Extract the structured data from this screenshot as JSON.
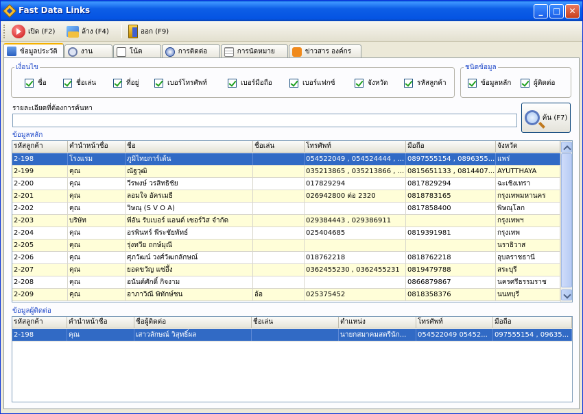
{
  "window": {
    "title": "Fast Data Links"
  },
  "toolbar": {
    "open": "เปิด (F2)",
    "clear": "ล้าง (F4)",
    "exit": "ออก (F9)"
  },
  "tabs": [
    "ข้อมูลประวัติ",
    "งาน",
    "โน้ต",
    "การติดต่อ",
    "การนัดหมาย",
    "ข่าวสาร องค์กร"
  ],
  "conditions": {
    "legend": "เงื่อนไข",
    "items": [
      "ชื่อ",
      "ชื่อเล่น",
      "ที่อยู่",
      "เบอร์โทรศัพท์",
      "เบอร์มือถือ",
      "เบอร์แฟกซ์",
      "จังหวัด",
      "รหัสลูกค้า"
    ]
  },
  "datatype": {
    "legend": "ชนิดข้อมูล",
    "items": [
      "ข้อมูลหลัก",
      "ผู้ติดต่อ"
    ]
  },
  "search": {
    "label": "รายละเอียดที่ต้องการค้นหา",
    "value": "",
    "button": "ค้น (F7)"
  },
  "main_grid": {
    "label": "ข้อมูลหลัก",
    "columns": [
      "รหัสลูกค้า",
      "คำนำหน้าชื่อ",
      "ชื่อ",
      "ชื่อเล่น",
      "โทรศัพท์",
      "มือถือ",
      "จังหวัด"
    ],
    "rows": [
      [
        "2-198",
        "โรงแรม",
        "ภูมิไทยการ์เด้น",
        "",
        "054522049 , 054524444 , ...",
        "0897555154 , 0896355...",
        "แพร่"
      ],
      [
        "2-199",
        "คุณ",
        "ณัฐวุฒิ",
        "",
        "035213865 , 035213866 , ...",
        "0815651133 , 0814407...",
        "AYUTTHAYA"
      ],
      [
        "2-200",
        "คุณ",
        "วีรพงษ์  วรสิทธิชัย",
        "",
        "017829294",
        "0817829294",
        "ฉะเชิงเทรา"
      ],
      [
        "2-201",
        "คุณ",
        "ลอมใจ  อัครเมธี",
        "",
        "026942800 ต่อ 2320",
        "0818783165",
        "กรุงเทพมหานคร"
      ],
      [
        "2-202",
        "คุณ",
        "วิษณุ (S V O A)",
        "",
        "",
        "0817858400",
        "พิษณุโลก"
      ],
      [
        "2-203",
        "บริษัท",
        "พีอัน รับเบอร์ แอนด์ เซอร์วิส จำกัด",
        "",
        "029384443 , 029386911",
        "",
        "กรุงเทพฯ"
      ],
      [
        "2-204",
        "คุณ",
        "อรพินทร์ พีระชัยพัทธ์",
        "",
        "025404685",
        "0819391981",
        "กรุงเทพ"
      ],
      [
        "2-205",
        "คุณ",
        "รุ่งทวีย  ถกษ์มุณี",
        "",
        "",
        "",
        "นราธิวาส"
      ],
      [
        "2-206",
        "คุณ",
        "ศุภวัฒน์  วงศ์วัฒกลักษณ์",
        "",
        "018762218",
        "0818762218",
        "อุบลราชธานี"
      ],
      [
        "2-207",
        "คุณ",
        "ยอดขวัญ  แซ่อึ้ง",
        "",
        "0362455230 , 0362455231",
        "0819479788",
        "สระบุรี"
      ],
      [
        "2-208",
        "คุณ",
        "อนันต์ศักดิ์ กิจงาม",
        "",
        "",
        "0866879867",
        "นครศรีธรรมราช"
      ],
      [
        "2-209",
        "คุณ",
        "อาภาวิณี  พิทักษ์ชน",
        "อ้อ",
        "025375452",
        "0818358376",
        "นนทบุรี"
      ]
    ]
  },
  "contact_grid": {
    "label": "ข้อมูลผู้ติดต่อ",
    "columns": [
      "รหัสลูกค้า",
      "คำนำหน้าชื่อ",
      "ชื่อผู้ติดต่อ",
      "ชื่อเล่น",
      "ตำแหน่ง",
      "โทรศัพท์",
      "มือถือ"
    ],
    "rows": [
      [
        "2-198",
        "คุณ",
        "เสาวลักษณ์  วิสุทธิ์ผล",
        "",
        "นายกสมาคมสตรีนัก...",
        "054522049  05452...",
        "097555154 , 09635..."
      ]
    ]
  },
  "colors": {
    "title_bar": "#0554e3",
    "selection": "#316ac5",
    "row_alt": "#fffed8",
    "legend_text": "#1c46c8"
  }
}
